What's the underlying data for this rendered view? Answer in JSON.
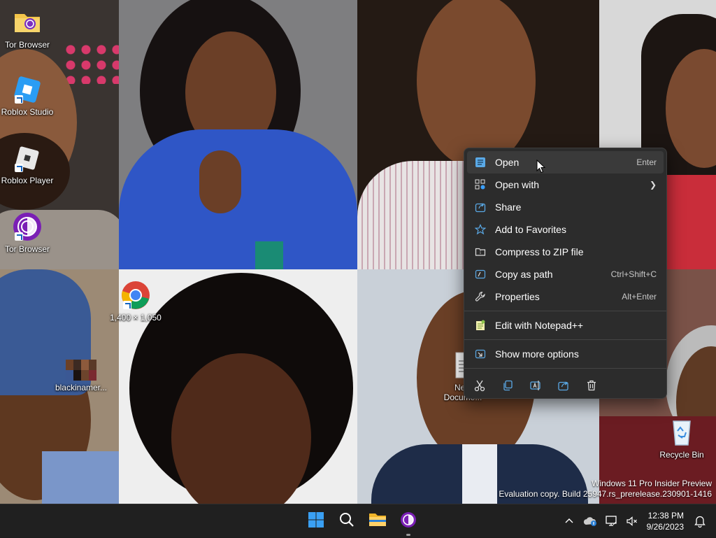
{
  "desktop": {
    "icons": [
      {
        "label": "Tor Browser",
        "icon": "tor-folder-icon"
      },
      {
        "label": "Roblox Studio",
        "icon": "roblox-studio-icon"
      },
      {
        "label": "Roblox Player",
        "icon": "roblox-player-icon"
      },
      {
        "label": "Tor Browser",
        "icon": "tor-browser-icon"
      },
      {
        "label": "1,400 × 1,050",
        "icon": "chrome-icon"
      },
      {
        "label": "blackinamer...",
        "icon": "image-file-icon"
      },
      {
        "label": "New\nDocume...",
        "icon": "text-document-icon"
      },
      {
        "label": "Recycle Bin",
        "icon": "recycle-bin-icon"
      }
    ],
    "watermark": {
      "line1": "Windows 11 Pro Insider Preview",
      "line2": "Evaluation copy. Build 25947.rs_prerelease.230901-1416"
    }
  },
  "context_menu": {
    "items": [
      {
        "label": "Open",
        "shortcut": "Enter",
        "icon": "open-icon"
      },
      {
        "label": "Open with",
        "shortcut": "",
        "icon": "open-with-icon",
        "submenu": true
      },
      {
        "label": "Share",
        "shortcut": "",
        "icon": "share-icon"
      },
      {
        "label": "Add to Favorites",
        "shortcut": "",
        "icon": "star-icon"
      },
      {
        "label": "Compress to ZIP file",
        "shortcut": "",
        "icon": "zip-icon"
      },
      {
        "label": "Copy as path",
        "shortcut": "Ctrl+Shift+C",
        "icon": "copy-path-icon"
      },
      {
        "label": "Properties",
        "shortcut": "Alt+Enter",
        "icon": "wrench-icon"
      },
      {
        "label": "Edit with Notepad++",
        "shortcut": "",
        "icon": "notepadpp-icon"
      },
      {
        "label": "Show more options",
        "shortcut": "",
        "icon": "more-options-icon"
      }
    ],
    "bottom_bar": [
      "cut-icon",
      "copy-icon",
      "rename-icon",
      "share-icon",
      "delete-icon"
    ]
  },
  "taskbar": {
    "apps": [
      "start-icon",
      "search-icon",
      "file-explorer-icon",
      "tor-browser-icon"
    ],
    "tray": {
      "time": "12:38 PM",
      "date": "9/26/2023"
    }
  },
  "colors": {
    "menu_bg": "#2c2c2c",
    "taskbar_bg": "#202020",
    "accent": "#0078d4"
  }
}
